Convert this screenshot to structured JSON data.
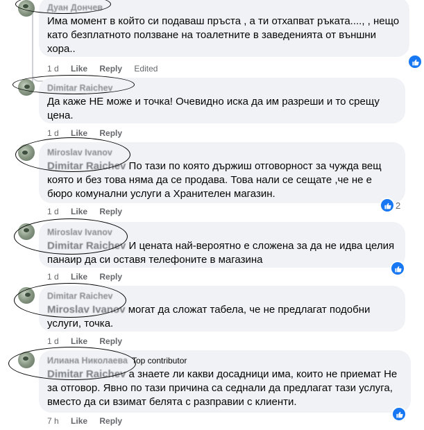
{
  "comments": [
    {
      "author": "Дуан Дончев",
      "text": "Има момент в който си подаваш пръста , а ти отхапват ръката...., , нещо като безплатното ползване на тоалетните в заведенията от външни хора..",
      "time": "1 d",
      "like": "Like",
      "reply": "Reply",
      "edited": "Edited"
    },
    {
      "author": "Dimitar Raichev",
      "text": "Да каже НЕ може и точка! Очевидно иска да им разреши и то срещу цена.",
      "time": "1 d",
      "like": "Like",
      "reply": "Reply"
    },
    {
      "author": "Miroslav Ivanov",
      "mention": "Dimitar Raichev",
      "text": " По тази по която държиш отговорност за чужда вещ която и без това няма да се продава. Това нали се сещате ,че не е бюро комунални услуги а Хранителен магазин.",
      "time": "1 d",
      "like": "Like",
      "reply": "Reply",
      "reaction_count": "2"
    },
    {
      "author": "Miroslav Ivanov",
      "mention": "Dimitar Raichev",
      "text": " И цената най-вероятно е сложена за да не идва целия панаир да си оставя телефоните в магазина",
      "time": "1 d",
      "like": "Like",
      "reply": "Reply"
    },
    {
      "author": "Dimitar Raichev",
      "mention": "Miroslav Ivanov",
      "text": " могат да сложат табела, че не предлагат подобни услуги, точка.",
      "time": "1 d",
      "like": "Like",
      "reply": "Reply"
    },
    {
      "author": "Илиана Николаева",
      "badge": "Top contributor",
      "mention": "Dimitar Raichev",
      "text": " а знаете ли какви досадници има, които не приемат Не за отговор. Явно по тази причина са седнали да предлагат тази услуга, вместо да си взимат белята с разправии с клиенти.",
      "time": "7 h",
      "like": "Like",
      "reply": "Reply"
    }
  ],
  "colors": {
    "bubble": "#f0f2f5",
    "like_blue": "#1877f2",
    "meta_gray": "#65676b"
  },
  "icons": [
    "avatar",
    "like-reaction-icon"
  ]
}
